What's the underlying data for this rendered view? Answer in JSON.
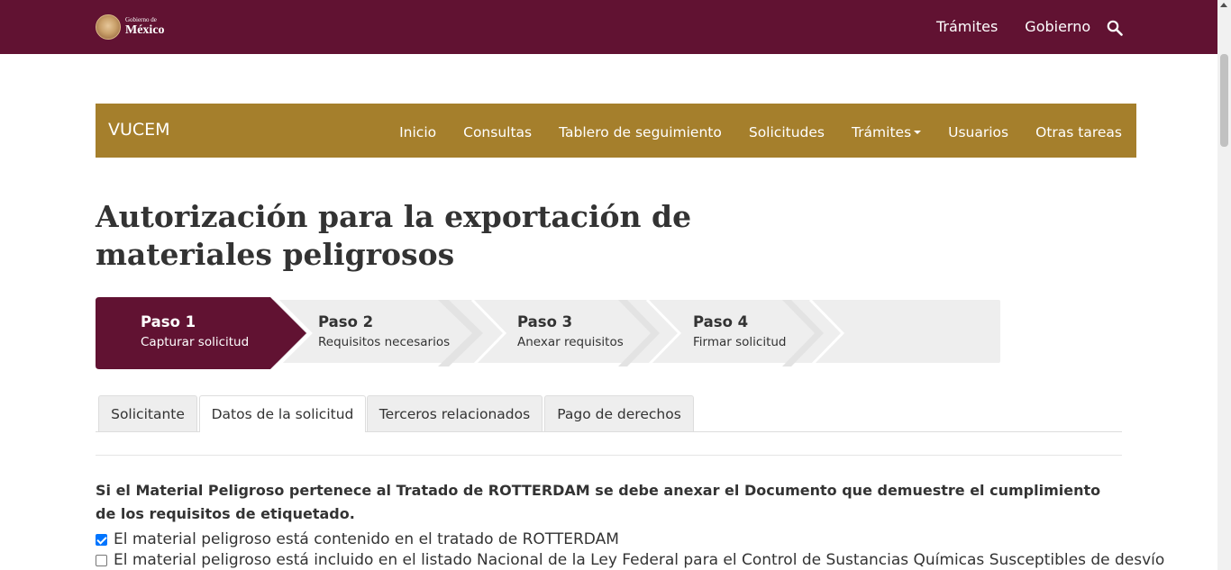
{
  "gov_header": {
    "logo_small": "Gobierno de",
    "logo_big": "México",
    "nav": [
      "Trámites",
      "Gobierno"
    ],
    "search_icon": "search-icon",
    "background": "#611232"
  },
  "vucem_nav": {
    "brand": "VUCEM",
    "items": [
      "Inicio",
      "Consultas",
      "Tablero de seguimiento",
      "Solicitudes",
      "Trámites",
      "Usuarios",
      "Otras tareas"
    ],
    "background": "#a57f2c"
  },
  "page": {
    "title_line1": "Autorización para la exportación de",
    "title_line2": "materiales peligrosos"
  },
  "stepper": {
    "steps": [
      {
        "title": "Paso 1",
        "subtitle": "Capturar solicitud",
        "active": true
      },
      {
        "title": "Paso 2",
        "subtitle": "Requisitos necesarios",
        "active": false
      },
      {
        "title": "Paso 3",
        "subtitle": "Anexar requisitos",
        "active": false
      },
      {
        "title": "Paso 4",
        "subtitle": "Firmar solicitud",
        "active": false
      }
    ],
    "active_color": "#611232"
  },
  "tabs": [
    {
      "label": "Solicitante",
      "active": false
    },
    {
      "label": "Datos de la solicitud",
      "active": true
    },
    {
      "label": "Terceros relacionados",
      "active": false
    },
    {
      "label": "Pago de derechos",
      "active": false
    }
  ],
  "content": {
    "notice": "Si el Material Peligroso pertenece al Tratado de ROTTERDAM se debe anexar el Documento que demuestre el cumplimiento de los requisitos de etiquetado.",
    "checkboxes": [
      {
        "label": "El material peligroso está contenido en el tratado de ROTTERDAM",
        "checked": true
      },
      {
        "label": "El material peligroso está incluido en el listado Nacional de la Ley Federal para el Control de Sustancias Químicas Susceptibles de desvío",
        "checked": false
      }
    ]
  }
}
